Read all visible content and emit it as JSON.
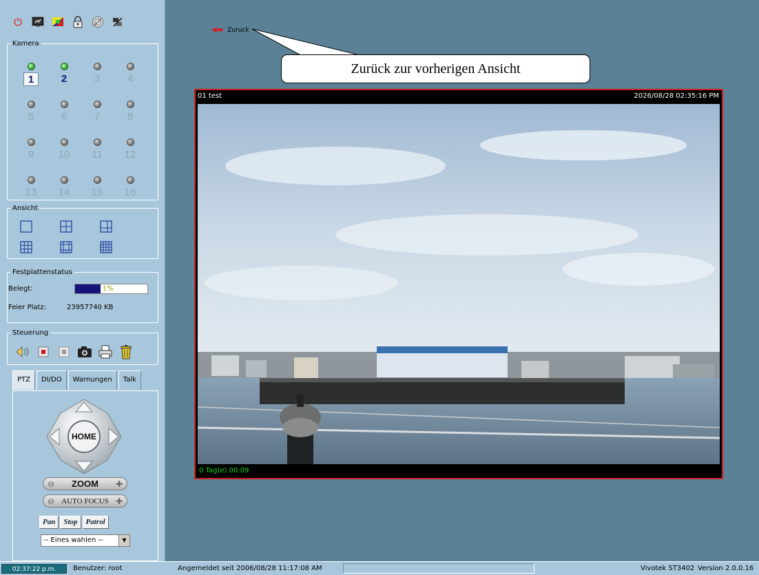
{
  "toolbar": {
    "icons": [
      "power-icon",
      "monitor-icon",
      "color-palette-icon",
      "lock-icon",
      "disabled-icon",
      "network-tools-icon"
    ]
  },
  "kamera": {
    "legend": "Kamera",
    "cameras": [
      {
        "num": "1",
        "status": "on",
        "state": "selected"
      },
      {
        "num": "2",
        "status": "on",
        "state": "active"
      },
      {
        "num": "3",
        "status": "off",
        "state": "inactive"
      },
      {
        "num": "4",
        "status": "off",
        "state": "inactive"
      },
      {
        "num": "5",
        "status": "off",
        "state": "inactive"
      },
      {
        "num": "6",
        "status": "off",
        "state": "inactive"
      },
      {
        "num": "7",
        "status": "off",
        "state": "inactive"
      },
      {
        "num": "8",
        "status": "off",
        "state": "inactive"
      },
      {
        "num": "9",
        "status": "off",
        "state": "inactive"
      },
      {
        "num": "10",
        "status": "off",
        "state": "inactive"
      },
      {
        "num": "11",
        "status": "off",
        "state": "inactive"
      },
      {
        "num": "12",
        "status": "off",
        "state": "inactive"
      },
      {
        "num": "13",
        "status": "off",
        "state": "inactive"
      },
      {
        "num": "14",
        "status": "off",
        "state": "inactive"
      },
      {
        "num": "15",
        "status": "off",
        "state": "inactive"
      },
      {
        "num": "16",
        "status": "off",
        "state": "inactive"
      }
    ]
  },
  "ansicht": {
    "legend": "Ansicht",
    "views": [
      "view-1x1-icon",
      "view-2x2-icon",
      "view-1plus3-icon",
      "view-3x3-icon",
      "view-1plus12-icon",
      "view-4x4-icon"
    ]
  },
  "festplatte": {
    "legend": "Festplattenstatus",
    "belegt_label": "Belegt:",
    "belegt_value": "1%",
    "belegt_fraction": 0.35,
    "frei_label": "Feier Platz:",
    "frei_value": "23957740 KB"
  },
  "steuerung": {
    "legend": "Steuerung",
    "icons": [
      "audio-icon",
      "record-icon",
      "stop-record-icon",
      "snapshot-icon",
      "print-icon",
      "delete-icon"
    ]
  },
  "tabs": [
    "PTZ",
    "DI/DO",
    "Warnungen",
    "Talk"
  ],
  "ptz": {
    "home": "HOME",
    "zoom": "ZOOM",
    "focus": "AUTO FOCUS",
    "buttons": [
      "Pan",
      "Stop",
      "Patrol"
    ],
    "select_value": "-- Eines wahlen --"
  },
  "main": {
    "back_link": "Zuruck",
    "callout": "Zurück zur vorherigen Ansicht",
    "viewer": {
      "camera_label": "01  test",
      "timestamp": "2026/08/28 02:35:16 PM",
      "footer": "0 Tag(e)  00:09"
    }
  },
  "status": {
    "clock": "02:37:22 p.m.",
    "user": "Benutzer: root",
    "login": "Angemeldet seit  2006/08/28 11:17:08 AM",
    "product": "Vivotek ST3402",
    "version": "Version 2.0.0.16"
  },
  "colors": {
    "background": "#5a8196",
    "sidebar": "#a9c7dc",
    "viewer_border": "#d02020",
    "disk_fill": "#14147a"
  }
}
